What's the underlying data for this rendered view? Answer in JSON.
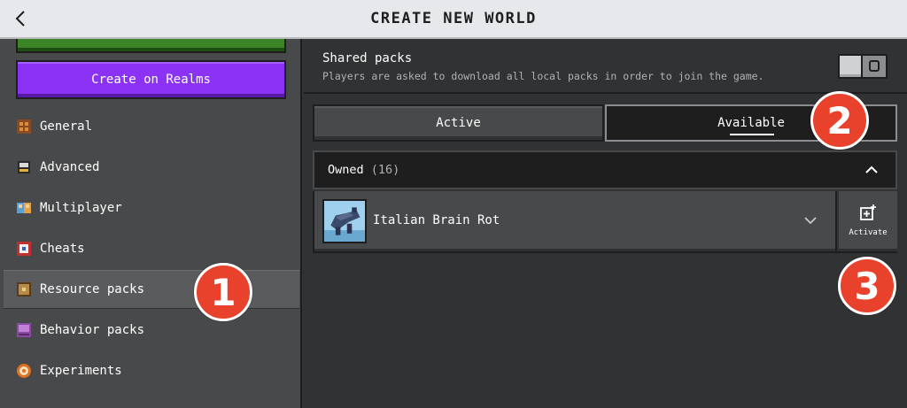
{
  "header": {
    "title": "CREATE NEW WORLD"
  },
  "sidebar": {
    "realms_button": "Create on Realms",
    "items": [
      {
        "label": "General",
        "icon": "general-icon"
      },
      {
        "label": "Advanced",
        "icon": "advanced-icon"
      },
      {
        "label": "Multiplayer",
        "icon": "multiplayer-icon"
      },
      {
        "label": "Cheats",
        "icon": "cheats-icon"
      },
      {
        "label": "Resource packs",
        "icon": "resource-packs-icon",
        "selected": true
      },
      {
        "label": "Behavior packs",
        "icon": "behavior-packs-icon"
      },
      {
        "label": "Experiments",
        "icon": "experiments-icon"
      }
    ]
  },
  "main": {
    "shared_packs": {
      "title": "Shared packs",
      "description": "Players are asked to download all local packs in order to join the game.",
      "toggle_on": false
    },
    "tabs": [
      {
        "label": "Active",
        "selected": false
      },
      {
        "label": "Available",
        "selected": true
      }
    ],
    "owned": {
      "label": "Owned",
      "count": "(16)"
    },
    "packs": [
      {
        "name": "Italian Brain Rot",
        "action_label": "Activate"
      }
    ]
  },
  "markers": [
    "1",
    "2",
    "3"
  ],
  "colors": {
    "realms_purple": "#8b32f5",
    "marker_red": "#e8412c",
    "header_bg": "#e6e8eb"
  }
}
